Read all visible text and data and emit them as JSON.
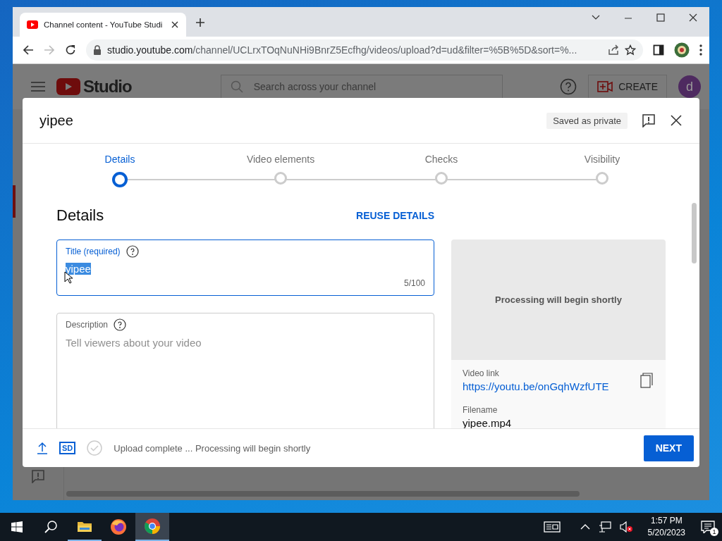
{
  "browser": {
    "tab_title": "Channel content - YouTube Studi",
    "address_host": "studio.youtube.com",
    "address_path": "/channel/UCLrxTOqNuNHi9BnrZ5Ecfhg/videos/upload?d=ud&filter=%5B%5D&sort=%..."
  },
  "studio_header": {
    "logo_text": "Studio",
    "search": {
      "placeholder": "Search across your channel"
    },
    "create_button": "CREATE",
    "avatar_letter": "d"
  },
  "dialog": {
    "title": "yipee",
    "status_chip": "Saved as private",
    "steps": [
      {
        "label": "Details",
        "selected": true
      },
      {
        "label": "Video elements",
        "selected": false
      },
      {
        "label": "Checks",
        "selected": false
      },
      {
        "label": "Visibility",
        "selected": false
      }
    ],
    "section_title": "Details",
    "reuse_button": "REUSE DETAILS",
    "title_field": {
      "label": "Title (required)",
      "value": "yipee",
      "text_selected": true,
      "counter": "5/100"
    },
    "description_field": {
      "label": "Description",
      "placeholder": "Tell viewers about your video"
    },
    "preview": {
      "message": "Processing will begin shortly",
      "video_link_label": "Video link",
      "video_link": "https://youtu.be/onGqhWzfUTE",
      "filename_label": "Filename",
      "filename": "yipee.mp4"
    },
    "footer": {
      "quality_badge": "SD",
      "status": "Upload complete ... Processing will begin shortly",
      "next_button": "NEXT"
    }
  },
  "taskbar": {
    "time": "1:57 PM",
    "date": "5/20/2023",
    "notification_count": "1"
  }
}
